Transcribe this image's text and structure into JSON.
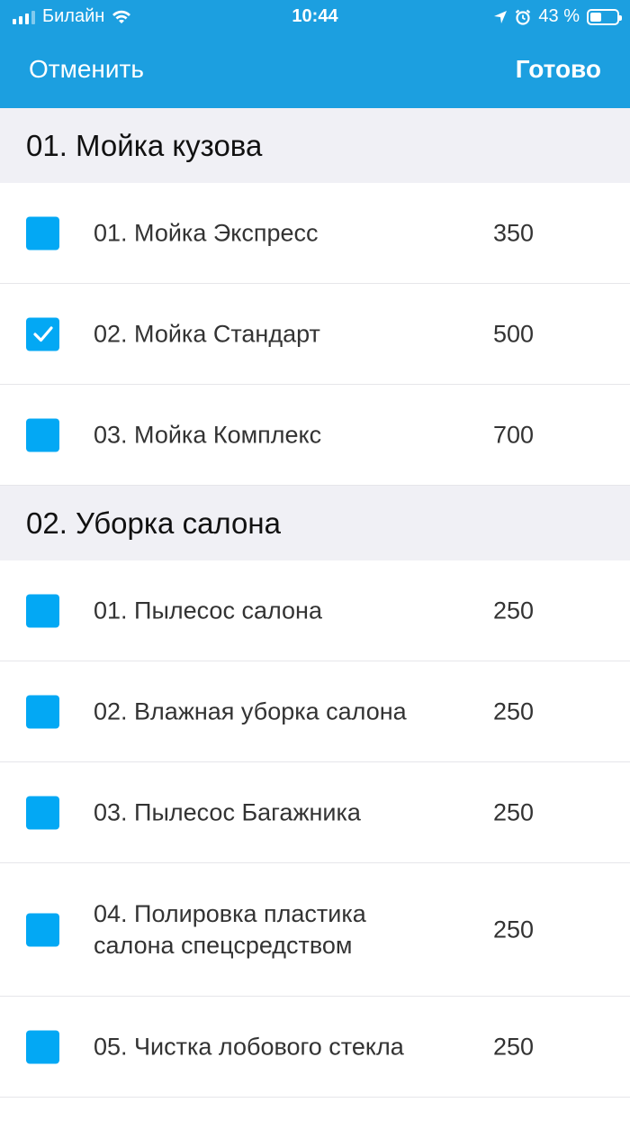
{
  "status_bar": {
    "carrier": "Билайн",
    "time": "10:44",
    "battery_percent": "43 %",
    "battery_level": 0.43
  },
  "nav": {
    "cancel_label": "Отменить",
    "done_label": "Готово"
  },
  "sections": [
    {
      "title": "01. Мойка кузова",
      "items": [
        {
          "name": "01. Мойка Экспресс",
          "price": "350",
          "checked": false
        },
        {
          "name": "02. Мойка Стандарт",
          "price": "500",
          "checked": true
        },
        {
          "name": "03. Мойка Комплекс",
          "price": "700",
          "checked": false
        }
      ]
    },
    {
      "title": "02. Уборка салона",
      "items": [
        {
          "name": "01. Пылесос салона",
          "price": "250",
          "checked": false
        },
        {
          "name": "02. Влажная уборка салона",
          "price": "250",
          "checked": false
        },
        {
          "name": "03. Пылесос Багажника",
          "price": "250",
          "checked": false
        },
        {
          "name": "04. Полировка пластика салона спецсредством",
          "price": "250",
          "checked": false
        },
        {
          "name": "05. Чистка лобового стекла",
          "price": "250",
          "checked": false
        }
      ]
    }
  ],
  "colors": {
    "header_blue": "#1c9fe0",
    "checkbox_blue": "#03a8f4",
    "section_bg": "#f0f0f5"
  },
  "icons": [
    "signal-icon",
    "wifi-icon",
    "location-icon",
    "alarm-icon",
    "battery-icon",
    "checkmark-icon"
  ]
}
